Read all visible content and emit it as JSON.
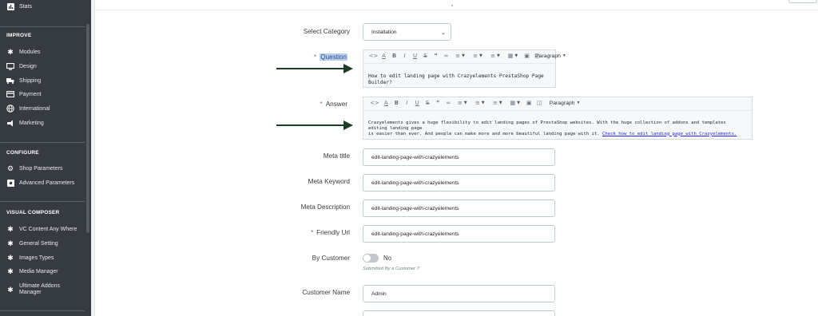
{
  "sidebar": {
    "top_item": {
      "label": "Stats",
      "icon": "stats-icon"
    },
    "sections": [
      {
        "title": "IMPROVE",
        "items": [
          {
            "label": "Modules",
            "icon": "puzzle-icon"
          },
          {
            "label": "Design",
            "icon": "monitor-icon"
          },
          {
            "label": "Shipping",
            "icon": "truck-icon"
          },
          {
            "label": "Payment",
            "icon": "credit-card-icon"
          },
          {
            "label": "International",
            "icon": "globe-icon"
          },
          {
            "label": "Marketing",
            "icon": "megaphone-icon"
          }
        ]
      },
      {
        "title": "CONFIGURE",
        "items": [
          {
            "label": "Shop Parameters",
            "icon": "gear-icon"
          },
          {
            "label": "Advanced Parameters",
            "icon": "settings-box-icon"
          }
        ]
      },
      {
        "title": "VISUAL COMPOSER",
        "items": [
          {
            "label": "VC Content Any Where",
            "icon": "puzzle-icon"
          },
          {
            "label": "General Setting",
            "icon": "puzzle-icon"
          },
          {
            "label": "Images Types",
            "icon": "puzzle-icon"
          },
          {
            "label": "Media Manager",
            "icon": "puzzle-icon"
          },
          {
            "label": "Ultimate Addons Manager",
            "label_line1": "Ultimate Addons",
            "label_line2": "Manager",
            "icon": "puzzle-icon"
          }
        ]
      }
    ]
  },
  "form": {
    "category": {
      "label": "Select Category",
      "value": "Installation"
    },
    "question": {
      "label": "Question",
      "required": "*",
      "content": "How to edit landing page with Crazyelements PrestaShop Page Builder?"
    },
    "answer": {
      "label": "Answer",
      "required": "*",
      "content_line1": "Crazyelements gives a huge flexibility to edit landing pages of PrestaShop websites. With the huge collection of addons and templates editing landing page",
      "content_line2": "is easier than ever. And people can make more and more beautiful landing page with it.",
      "link_text": "Check how to edit landing page with Crazyelements."
    },
    "editor_toolbar": {
      "code": "<>",
      "text_color": "A",
      "bold": "B",
      "italic": "I",
      "underline": "U",
      "strikethrough": "S",
      "quote": "”",
      "link": "∞",
      "paragraph": "Paragraph"
    },
    "meta_title": {
      "label": "Meta title",
      "value": "edit-landing-page-with-crazyelements"
    },
    "meta_keyword": {
      "label": "Meta Keyword",
      "value": "edit-landing-page-with-crazyelements"
    },
    "meta_description": {
      "label": "Meta Description",
      "value": "edit-landing-page-with-crazyelements"
    },
    "friendly_url": {
      "label": "Friendly Url",
      "required": "*",
      "value": "edit-landing-page-with-crazyelements"
    },
    "by_customer": {
      "label": "By Customer",
      "state": "No",
      "help": "Submitted By a Customer ?"
    },
    "customer_name": {
      "label": "Customer Name",
      "value": "Admin"
    }
  },
  "colors": {
    "sidebar_bg": "#363a41",
    "required": "#c05c67",
    "link": "#2525ff",
    "arrow": "#1d3d24",
    "highlight": "#b7d1ee"
  }
}
